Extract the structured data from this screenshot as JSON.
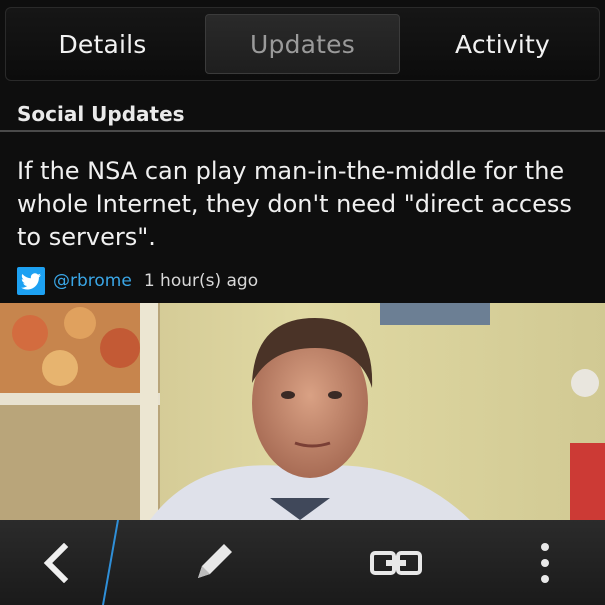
{
  "tabs": [
    {
      "label": "Details",
      "active": false
    },
    {
      "label": "Updates",
      "active": true
    },
    {
      "label": "Activity",
      "active": false
    }
  ],
  "section": {
    "title": "Social Updates"
  },
  "post": {
    "text": "If the NSA can play man-in-the-middle for the whole Internet, they don't need \"direct access to servers\".",
    "handle": "@rbrome",
    "time": "1 hour(s) ago",
    "source_icon": "twitter-icon"
  },
  "image": {
    "subject": "video-thumbnail"
  },
  "bottom_bar": {
    "icons": [
      "back-chevron-icon",
      "pencil-icon",
      "link-icon",
      "overflow-menu-icon"
    ]
  },
  "colors": {
    "accent_blue": "#1da1f2",
    "handle_blue": "#3aa6e6",
    "background": "#0e0e0e"
  }
}
